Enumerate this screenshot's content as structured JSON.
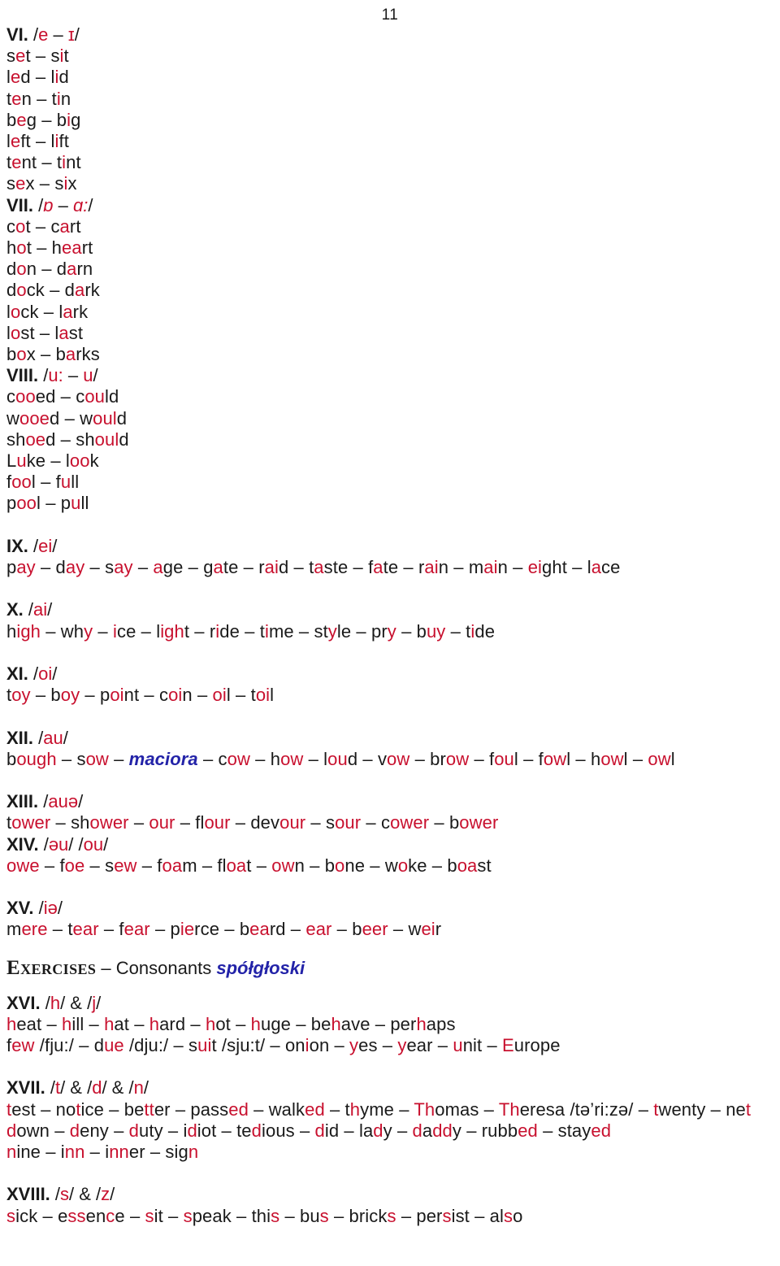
{
  "page": {
    "number": "11",
    "colors": {
      "highlight_red": "#c8102e",
      "gloss_blue": "#2323a8",
      "text_black": "#1a1a1a",
      "background": "#ffffff"
    }
  },
  "sections": {
    "vi": {
      "roman": "VI.",
      "ipa_open": "/",
      "ipa_a": "e",
      "ipa_dash": " – ",
      "ipa_b": "ɪ",
      "ipa_close": "/",
      "pairs": [
        {
          "left_pre": "s",
          "left_hl": "e",
          "left_post": "t",
          "sep": " – ",
          "right_pre": "s",
          "right_hl": "i",
          "right_post": "t"
        },
        {
          "left_pre": "l",
          "left_hl": "e",
          "left_post": "d",
          "sep": " – ",
          "right_pre": "l",
          "right_hl": "i",
          "right_post": "d"
        },
        {
          "left_pre": "t",
          "left_hl": "e",
          "left_post": "n",
          "sep": " – ",
          "right_pre": "t",
          "right_hl": "i",
          "right_post": "n"
        },
        {
          "left_pre": "b",
          "left_hl": "e",
          "left_post": "g",
          "sep": " – ",
          "right_pre": "b",
          "right_hl": "i",
          "right_post": "g"
        },
        {
          "left_pre": "l",
          "left_hl": "e",
          "left_post": "ft",
          "sep": " – ",
          "right_pre": "l",
          "right_hl": "i",
          "right_post": "ft"
        },
        {
          "left_pre": "t",
          "left_hl": "e",
          "left_post": "nt",
          "sep": " – ",
          "right_pre": "t",
          "right_hl": "i",
          "right_post": "nt"
        },
        {
          "left_pre": "s",
          "left_hl": "e",
          "left_post": "x",
          "sep": " – ",
          "right_pre": "s",
          "right_hl": "i",
          "right_post": "x"
        }
      ]
    },
    "vii": {
      "roman": "VII.",
      "ipa_open": "/",
      "ipa_a": "ɒ",
      "ipa_dash": " – ",
      "ipa_b": "ɑ:",
      "ipa_close": "/",
      "pairs": [
        {
          "left_pre": "c",
          "left_hl": "o",
          "left_post": "t",
          "sep": " – ",
          "right_pre": "c",
          "right_hl": "a",
          "right_post": "rt"
        },
        {
          "left_pre": "h",
          "left_hl": "o",
          "left_post": "t",
          "sep": " – ",
          "right_pre": "h",
          "right_hl": "ea",
          "right_post": "rt"
        },
        {
          "left_pre": "d",
          "left_hl": "o",
          "left_post": "n",
          "sep": " – ",
          "right_pre": "d",
          "right_hl": "a",
          "right_post": "rn"
        },
        {
          "left_pre": "d",
          "left_hl": "o",
          "left_post": "ck",
          "sep": " – ",
          "right_pre": "d",
          "right_hl": "a",
          "right_post": "rk"
        },
        {
          "left_pre": "l",
          "left_hl": "o",
          "left_post": "ck",
          "sep": " – ",
          "right_pre": "l",
          "right_hl": "a",
          "right_post": "rk"
        },
        {
          "left_pre": "l",
          "left_hl": "o",
          "left_post": "st",
          "sep": " – ",
          "right_pre": "l",
          "right_hl": "a",
          "right_post": "st"
        },
        {
          "left_pre": "b",
          "left_hl": "o",
          "left_post": "x",
          "sep": " – ",
          "right_pre": "b",
          "right_hl": "a",
          "right_post": "rks"
        }
      ]
    },
    "viii": {
      "roman": "VIII.",
      "ipa_open": "/",
      "ipa_a": "u:",
      "ipa_dash": " – ",
      "ipa_b": "u",
      "ipa_close": "/",
      "pairs": [
        {
          "left_pre": "c",
          "left_hl": "oo",
          "left_post": "ed",
          "sep": " – ",
          "right_pre": "c",
          "right_hl": "ou",
          "right_post": "ld"
        },
        {
          "left_pre": "w",
          "left_hl": "ooe",
          "left_post": "d",
          "sep": " – ",
          "right_pre": "w",
          "right_hl": "oul",
          "right_post": "d"
        },
        {
          "left_pre": "sh",
          "left_hl": "oe",
          "left_post": "d",
          "sep": " – ",
          "right_pre": "sh",
          "right_hl": "oul",
          "right_post": "d"
        },
        {
          "left_pre": "L",
          "left_hl": "u",
          "left_post": "ke",
          "sep": " – ",
          "right_pre": "l",
          "right_hl": "oo",
          "right_post": "k"
        },
        {
          "left_pre": "f",
          "left_hl": "oo",
          "left_post": "l",
          "sep": " – ",
          "right_pre": "f",
          "right_hl": "u",
          "right_post": "ll"
        },
        {
          "left_pre": "p",
          "left_hl": "oo",
          "left_post": "l",
          "sep": " – ",
          "right_pre": "p",
          "right_hl": "u",
          "right_post": "ll"
        }
      ]
    },
    "ix": {
      "roman": "IX.",
      "ipa_open": "/",
      "ipa_a": "ei",
      "ipa_close": "/",
      "words": [
        {
          "pre": "p",
          "hl": "ay",
          "post": ""
        },
        {
          "pre": "d",
          "hl": "ay",
          "post": ""
        },
        {
          "pre": "s",
          "hl": "ay",
          "post": ""
        },
        {
          "pre": "",
          "hl": "a",
          "post": "ge"
        },
        {
          "pre": "g",
          "hl": "a",
          "post": "te"
        },
        {
          "pre": "r",
          "hl": "ai",
          "post": "d"
        },
        {
          "pre": "t",
          "hl": "a",
          "post": "ste"
        },
        {
          "pre": "f",
          "hl": "a",
          "post": "te"
        },
        {
          "pre": "r",
          "hl": "ai",
          "post": "n"
        },
        {
          "pre": "m",
          "hl": "ai",
          "post": "n"
        },
        {
          "pre": "",
          "hl": "ei",
          "post": "ght"
        },
        {
          "pre": "l",
          "hl": "a",
          "post": "ce"
        }
      ],
      "sep": " – "
    },
    "x": {
      "roman": "X.",
      "ipa_open": "/",
      "ipa_a": "ai",
      "ipa_close": "/",
      "words": [
        {
          "pre": "h",
          "hl": "igh",
          "post": ""
        },
        {
          "pre": "wh",
          "hl": "y",
          "post": ""
        },
        {
          "pre": "",
          "hl": "i",
          "post": "ce"
        },
        {
          "pre": "l",
          "hl": "igh",
          "post": "t"
        },
        {
          "pre": "r",
          "hl": "i",
          "post": "de"
        },
        {
          "pre": "t",
          "hl": "i",
          "post": "me"
        },
        {
          "pre": "st",
          "hl": "y",
          "post": "le"
        },
        {
          "pre": "pr",
          "hl": "y",
          "post": ""
        },
        {
          "pre": "b",
          "hl": "uy",
          "post": ""
        },
        {
          "pre": "t",
          "hl": "i",
          "post": "de"
        }
      ],
      "sep": " – "
    },
    "xi": {
      "roman": "XI.",
      "ipa_open": "/",
      "ipa_a": "oi",
      "ipa_close": "/",
      "words": [
        {
          "pre": "t",
          "hl": "oy",
          "post": ""
        },
        {
          "pre": "b",
          "hl": "oy",
          "post": ""
        },
        {
          "pre": "p",
          "hl": "oi",
          "post": "nt"
        },
        {
          "pre": "c",
          "hl": "oi",
          "post": "n"
        },
        {
          "pre": "",
          "hl": "oi",
          "post": "l"
        },
        {
          "pre": "t",
          "hl": "oi",
          "post": "l"
        }
      ],
      "sep": " – "
    },
    "xii": {
      "roman": "XII.",
      "ipa_open": "/",
      "ipa_a": "au",
      "ipa_close": "/",
      "words": [
        {
          "pre": "b",
          "hl": "ough",
          "post": ""
        },
        {
          "pre": "s",
          "hl": "ow",
          "post": ""
        },
        {
          "gloss": "maciora"
        },
        {
          "pre": "c",
          "hl": "ow",
          "post": ""
        },
        {
          "pre": "h",
          "hl": "ow",
          "post": ""
        },
        {
          "pre": "l",
          "hl": "ou",
          "post": "d"
        },
        {
          "pre": "v",
          "hl": "ow",
          "post": ""
        },
        {
          "pre": "br",
          "hl": "ow",
          "post": ""
        },
        {
          "pre": "f",
          "hl": "ou",
          "post": "l"
        },
        {
          "pre": "f",
          "hl": "ow",
          "post": "l"
        },
        {
          "pre": "h",
          "hl": "ow",
          "post": "l"
        },
        {
          "pre": "",
          "hl": "ow",
          "post": "l"
        }
      ],
      "sep": " – "
    },
    "xiii": {
      "roman": "XIII.",
      "ipa_open": "/",
      "ipa_a": "auə",
      "ipa_close": "/",
      "words": [
        {
          "pre": "t",
          "hl": "ower",
          "post": ""
        },
        {
          "pre": "sh",
          "hl": "ower",
          "post": ""
        },
        {
          "pre": "",
          "hl": "our",
          "post": ""
        },
        {
          "pre": "fl",
          "hl": "our",
          "post": ""
        },
        {
          "pre": "dev",
          "hl": "our",
          "post": ""
        },
        {
          "pre": "s",
          "hl": "our",
          "post": ""
        },
        {
          "pre": "c",
          "hl": "ower",
          "post": ""
        },
        {
          "pre": "b",
          "hl": "ower",
          "post": ""
        }
      ],
      "sep": " – "
    },
    "xiv": {
      "roman": "XIV.",
      "ipa_open": "/",
      "ipa_a": "əu",
      "ipa_mid": "/ /",
      "ipa_b": "ou",
      "ipa_close": "/",
      "words": [
        {
          "pre": "",
          "hl": "owe",
          "post": ""
        },
        {
          "pre": "f",
          "hl": "oe",
          "post": ""
        },
        {
          "pre": "s",
          "hl": "ew",
          "post": ""
        },
        {
          "pre": "f",
          "hl": "oa",
          "post": "m"
        },
        {
          "pre": "fl",
          "hl": "oa",
          "post": "t"
        },
        {
          "pre": "",
          "hl": "ow",
          "post": "n"
        },
        {
          "pre": "b",
          "hl": "o",
          "post": "ne"
        },
        {
          "pre": "w",
          "hl": "o",
          "post": "ke"
        },
        {
          "pre": "b",
          "hl": "oa",
          "post": "st"
        }
      ],
      "sep": " – "
    },
    "xv": {
      "roman": "XV.",
      "ipa_open": "/",
      "ipa_a": "iə",
      "ipa_close": "/",
      "words": [
        {
          "pre": "m",
          "hl": "ere",
          "post": ""
        },
        {
          "pre": "t",
          "hl": "ear",
          "post": ""
        },
        {
          "pre": "f",
          "hl": "ear",
          "post": ""
        },
        {
          "pre": "p",
          "hl": "ie",
          "post": "rce"
        },
        {
          "pre": "b",
          "hl": "ea",
          "post": "rd"
        },
        {
          "pre": "",
          "hl": "ear",
          "post": ""
        },
        {
          "pre": "b",
          "hl": "eer",
          "post": ""
        },
        {
          "pre": "w",
          "hl": "ei",
          "post": "r"
        }
      ],
      "sep": " – "
    },
    "xvi": {
      "roman": "XVI.",
      "ipa_open": "/",
      "ipa_a": "h",
      "ipa_mid": "/ & /",
      "ipa_b": "j",
      "ipa_close": "/",
      "line1": [
        {
          "pre": "",
          "hl": "h",
          "post": "eat"
        },
        {
          "pre": "",
          "hl": "h",
          "post": "ill"
        },
        {
          "pre": "",
          "hl": "h",
          "post": "at"
        },
        {
          "pre": "",
          "hl": "h",
          "post": "ard"
        },
        {
          "pre": "",
          "hl": "h",
          "post": "ot"
        },
        {
          "pre": "",
          "hl": "h",
          "post": "uge"
        },
        {
          "pre": "be",
          "hl": "h",
          "post": "ave"
        },
        {
          "pre": "per",
          "hl": "h",
          "post": "aps"
        }
      ],
      "line2": [
        {
          "pre": "f",
          "hl": "ew",
          "post": "",
          "ipa": "/fju:/"
        },
        {
          "pre": "d",
          "hl": "ue",
          "post": "",
          "ipa": "/dju:/"
        },
        {
          "pre": "s",
          "hl": "ui",
          "post": "t",
          "ipa": "/sju:t/"
        },
        {
          "pre": "on",
          "hl": "i",
          "post": "on"
        },
        {
          "pre": "",
          "hl": "y",
          "post": "es"
        },
        {
          "pre": "",
          "hl": "y",
          "post": "ear"
        },
        {
          "pre": "",
          "hl": "u",
          "post": "nit"
        },
        {
          "pre": "",
          "hl": "E",
          "post": "urope"
        }
      ],
      "sep": " – "
    },
    "xvii": {
      "roman": "XVII.",
      "ipa_open": "/",
      "ipa_a": "t",
      "ipa_mid1": "/ & /",
      "ipa_b": "d",
      "ipa_mid2": "/ & /",
      "ipa_c": "n",
      "ipa_close": "/",
      "line1": [
        {
          "pre": "",
          "hl": "t",
          "post": "est"
        },
        {
          "pre": "no",
          "hl": "t",
          "post": "ice"
        },
        {
          "pre": "be",
          "hl": "tt",
          "post": "er"
        },
        {
          "pre": "pass",
          "hl": "ed",
          "post": ""
        },
        {
          "pre": "walk",
          "hl": "ed",
          "post": ""
        },
        {
          "pre": "t",
          "hl": "h",
          "post": "yme"
        },
        {
          "pre": "",
          "hl": "Th",
          "post": "omas"
        },
        {
          "pre": "",
          "hl": "Th",
          "post": "eresa",
          "ipa": "/tə’ri:zə/"
        },
        {
          "pre": "",
          "hl": "t",
          "post": "wenty"
        },
        {
          "pre": "ne",
          "hl": "t",
          "post": ""
        }
      ],
      "line2": [
        {
          "pre": "",
          "hl": "d",
          "post": "own"
        },
        {
          "pre": "",
          "hl": "d",
          "post": "eny"
        },
        {
          "pre": "",
          "hl": "d",
          "post": "uty"
        },
        {
          "pre": "i",
          "hl": "d",
          "post": "iot"
        },
        {
          "pre": "te",
          "hl": "d",
          "post": "ious"
        },
        {
          "pre": "",
          "hl": "d",
          "post": "id"
        },
        {
          "pre": "la",
          "hl": "d",
          "post": "y"
        },
        {
          "pre": "",
          "hl": "d",
          "post": "a",
          "hl2": "dd",
          "post2": "y"
        },
        {
          "pre": "rubb",
          "hl": "ed",
          "post": ""
        },
        {
          "pre": "stay",
          "hl": "ed",
          "post": ""
        }
      ],
      "line3": [
        {
          "pre": "",
          "hl": "n",
          "post": "ine"
        },
        {
          "pre": "i",
          "hl": "nn",
          "post": ""
        },
        {
          "pre": "i",
          "hl": "nn",
          "post": "er"
        },
        {
          "pre": "sig",
          "hl": "n",
          "post": ""
        }
      ],
      "sep": " – "
    },
    "xviii": {
      "roman": "XVIII.",
      "ipa_open": "/",
      "ipa_a": "s",
      "ipa_mid": "/ & /",
      "ipa_b": "z",
      "ipa_close": "/",
      "words": [
        {
          "pre": "",
          "hl": "s",
          "post": "ick"
        },
        {
          "pre": "e",
          "hl": "ss",
          "post": "en",
          "hl2": "c",
          "post2": "e"
        },
        {
          "pre": "",
          "hl": "s",
          "post": "it"
        },
        {
          "pre": "",
          "hl": "s",
          "post": "peak"
        },
        {
          "pre": "thi",
          "hl": "s",
          "post": ""
        },
        {
          "pre": "bu",
          "hl": "s",
          "post": ""
        },
        {
          "pre": "brick",
          "hl": "s",
          "post": ""
        },
        {
          "pre": "per",
          "hl": "s",
          "post": "ist"
        },
        {
          "pre": "al",
          "hl": "s",
          "post": "o"
        }
      ],
      "sep": " – "
    }
  },
  "exercises_heading": {
    "title": "Exercises",
    "dash": " – ",
    "subject": "Consonants",
    "gloss": "spółgłoski"
  }
}
